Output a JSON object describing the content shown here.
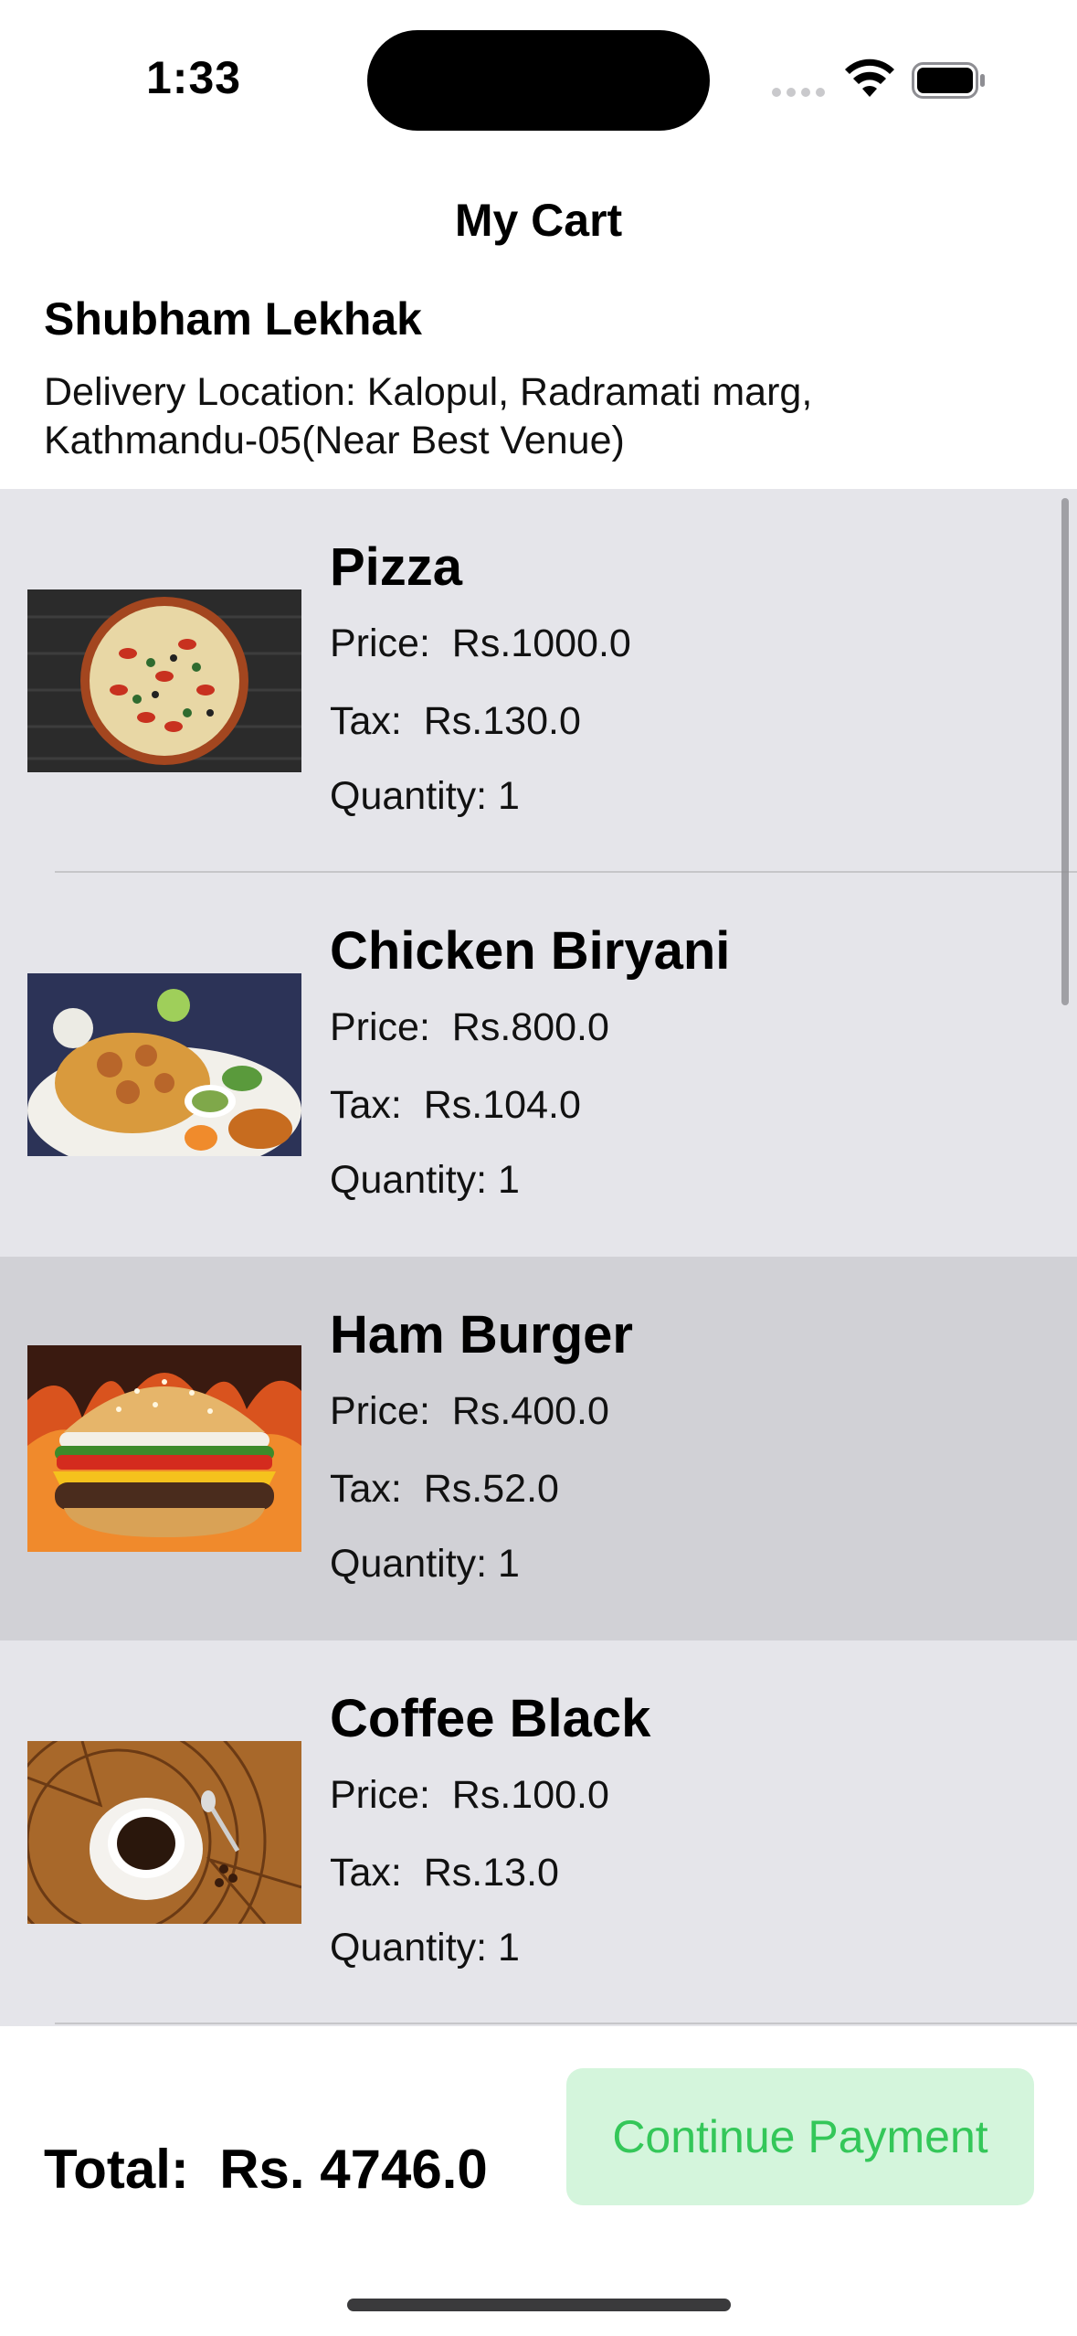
{
  "status_bar": {
    "time": "1:33",
    "icons": [
      "cellular-signal-icon",
      "wifi-icon",
      "battery-icon"
    ]
  },
  "header": {
    "title": "My Cart",
    "customer_name": "Shubham Lekhak",
    "delivery_location": "Delivery Location: Kalopul, Radramati marg, Kathmandu-05(Near Best Venue)"
  },
  "cart": {
    "items": [
      {
        "name": "Pizza",
        "price": "Price:  Rs.1000.0",
        "tax": "Tax:  Rs.130.0",
        "quantity": "Quantity: 1",
        "image": "pizza-image"
      },
      {
        "name": "Chicken Biryani",
        "price": "Price:  Rs.800.0",
        "tax": "Tax:  Rs.104.0",
        "quantity": "Quantity: 1",
        "image": "biryani-image"
      },
      {
        "name": "Ham Burger",
        "price": "Price:  Rs.400.0",
        "tax": "Tax:  Rs.52.0",
        "quantity": "Quantity: 1",
        "image": "burger-image",
        "selected": true
      },
      {
        "name": "Coffee Black",
        "price": "Price:  Rs.100.0",
        "tax": "Tax:  Rs.13.0",
        "quantity": "Quantity: 1",
        "image": "coffee-image"
      }
    ]
  },
  "footer": {
    "total": "Total:  Rs. 4746.0",
    "continue_button": "Continue Payment"
  },
  "colors": {
    "list_background": "#e5e5ea",
    "selected_row": "#d1d1d6",
    "button_background": "#d4f5dc",
    "button_text": "#34c759"
  }
}
